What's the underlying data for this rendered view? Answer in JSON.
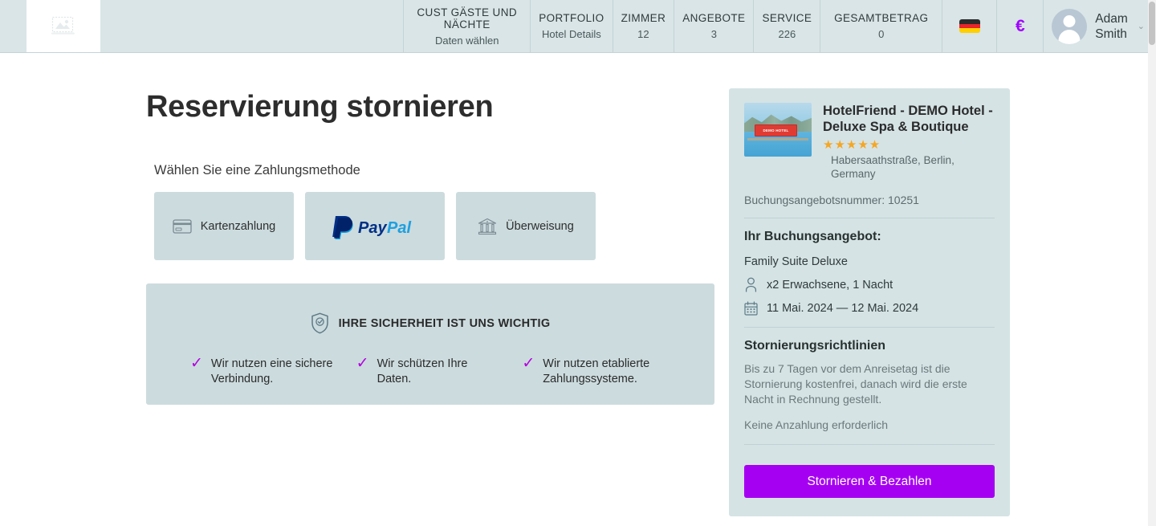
{
  "header": {
    "logo_icon": "broken-image-icon",
    "stats": [
      {
        "label": "CUST GÄSTE UND NÄCHTE",
        "value": "Daten wählen"
      },
      {
        "label": "PORTFOLIO",
        "value": "Hotel Details"
      },
      {
        "label": "ZIMMER",
        "value": "12"
      },
      {
        "label": "ANGEBOTE",
        "value": "3"
      },
      {
        "label": "SERVICE",
        "value": "226"
      },
      {
        "label": "GESAMTBETRAG",
        "value": "0"
      }
    ],
    "language_icon": "german-flag-icon",
    "currency_symbol": "€",
    "currency_icon": "euro-icon",
    "user_name": "Adam Smith",
    "user_chevron": "⌄",
    "avatar_icon": "user-avatar-icon"
  },
  "main": {
    "title": "Reservierung stornieren",
    "payment_prompt": "Wählen Sie eine Zahlungsmethode",
    "payment_methods": [
      {
        "label": "Kartenzahlung",
        "icon": "credit-card-icon"
      },
      {
        "label": "PayPal",
        "icon": "paypal-logo-icon"
      },
      {
        "label": "Überweisung",
        "icon": "bank-icon"
      }
    ],
    "security": {
      "icon": "shield-check-icon",
      "heading": "IHRE SICHERHEIT IST UNS WICHTIG",
      "check_icon": "checkmark-icon",
      "items": [
        "Wir nutzen eine sichere Verbindung.",
        "Wir schützen Ihre Daten.",
        "Wir nutzen etablierte Zahlungssysteme."
      ]
    }
  },
  "card": {
    "thumb_icon": "hotel-thumbnail-image",
    "thumb_sign_text": "DEMO HOTEL",
    "hotel_name": "HotelFriend - DEMO Hotel - Deluxe Spa & Boutique",
    "stars": "★★★★★",
    "address": "Habersaathstraße, Berlin, Germany",
    "booking_number": "Buchungsangebotsnummer: 10251",
    "offer_title": "Ihr Buchungsangebot:",
    "room": "Family Suite Deluxe",
    "guests_icon": "person-icon",
    "guests": "x2 Erwachsene, 1 Nacht",
    "dates_icon": "calendar-icon",
    "dates": "11 Mai. 2024 — 12 Mai. 2024",
    "policy_title": "Stornierungsrichtlinien",
    "policy_text": "Bis zu 7 Tagen vor dem Anreisetag ist die Stornierung kostenfrei, danach wird die erste Nacht in Rechnung gestellt.",
    "policy_note": "Keine Anzahlung erforderlich",
    "cta_label": "Stornieren & Bezahlen"
  },
  "colors": {
    "header_bg": "#d9e5e7",
    "panel_bg": "#ccdbde",
    "card_bg": "#d5e3e5",
    "accent": "#a600f2",
    "check": "#b400e0",
    "star": "#f5a623"
  }
}
